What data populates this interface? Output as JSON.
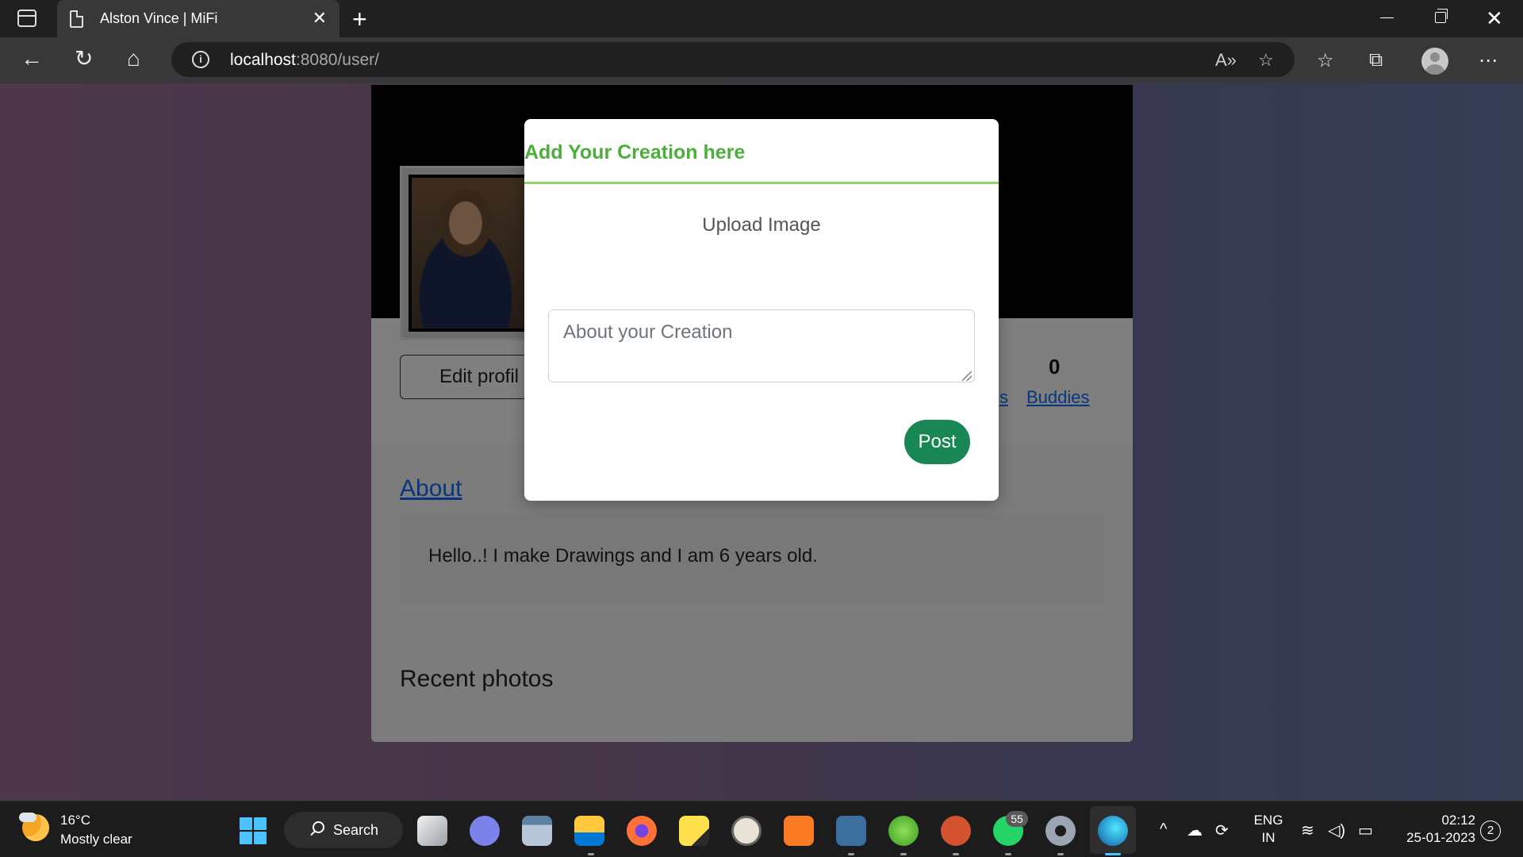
{
  "browser": {
    "tab_title": "Alston Vince | MiFi",
    "url_host": "localhost",
    "url_rest": ":8080/user/"
  },
  "profile": {
    "edit_button": "Edit profil",
    "stat_value": "0",
    "stat_partial_link": "s",
    "buddies_link": "Buddies",
    "about_heading": "About",
    "about_text": "Hello..! I make Drawings and I am 6 years old.",
    "recent_photos": "Recent photos"
  },
  "modal": {
    "title": "Add Your Creation here",
    "upload_label": "Upload Image",
    "about_placeholder": "About your Creation",
    "post_button": "Post"
  },
  "taskbar": {
    "weather_temp": "16°C",
    "weather_desc": "Mostly clear",
    "search_label": "Search",
    "whatsapp_badge": "55",
    "lang_line1": "ENG",
    "lang_line2": "IN",
    "time": "02:12",
    "date": "25-01-2023",
    "notification_count": "2",
    "apps": [
      "task-view",
      "teams-chat",
      "calculator",
      "file-explorer",
      "firefox",
      "sticky-notes",
      "compass",
      "xampp",
      "mysql-workbench",
      "spring-tool-suite",
      "powerpoint",
      "whatsapp",
      "settings",
      "edge"
    ]
  },
  "colors": {
    "modal_title": "#4caf3a",
    "modal_divider": "#8fd36b",
    "post_button": "#198754",
    "link": "#0d6efd",
    "windows_accent": "#4cc2ff"
  }
}
